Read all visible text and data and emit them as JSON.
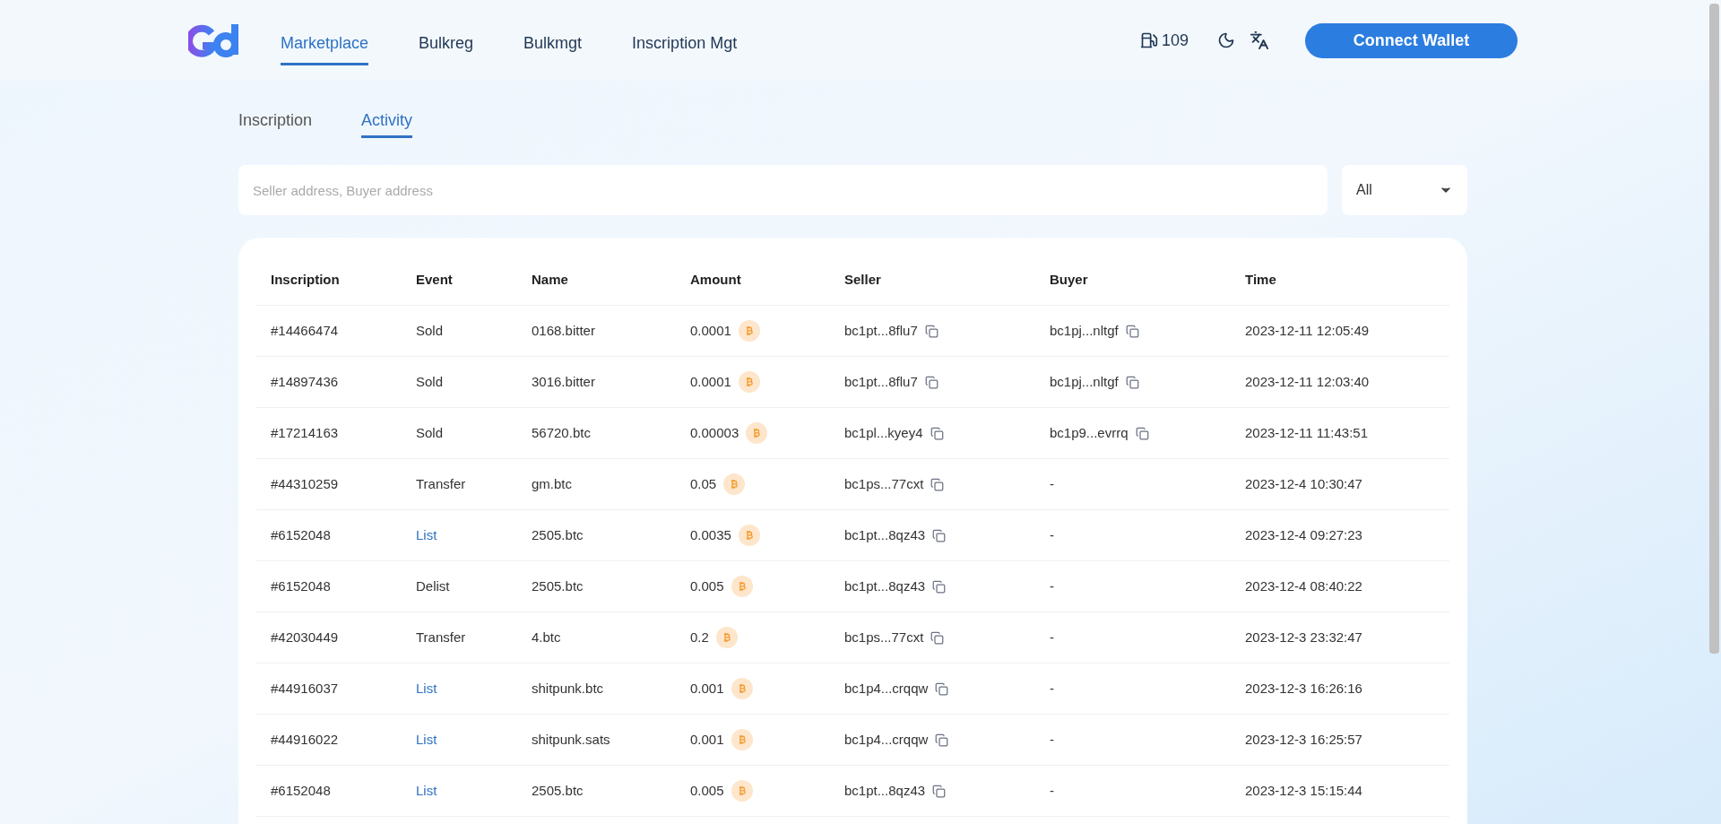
{
  "nav": {
    "items": [
      {
        "label": "Marketplace",
        "selected": true
      },
      {
        "label": "Bulkreg",
        "selected": false
      },
      {
        "label": "Bulkmgt",
        "selected": false
      },
      {
        "label": "Inscription Mgt",
        "selected": false
      }
    ],
    "gas": "109",
    "connect_button": "Connect Wallet"
  },
  "tabs": [
    {
      "label": "Inscription",
      "selected": false
    },
    {
      "label": "Activity",
      "selected": true
    }
  ],
  "search": {
    "placeholder": "Seller address, Buyer address"
  },
  "filter": {
    "value": "All"
  },
  "table": {
    "columns": [
      "Inscription",
      "Event",
      "Name",
      "Amount",
      "Seller",
      "Buyer",
      "Time"
    ],
    "rows": [
      {
        "inscription": "#14466474",
        "event": "Sold",
        "kind": "text",
        "name": "0168.bitter",
        "amount": "0.0001",
        "seller": "bc1pt...8flu7",
        "buyer": "bc1pj...nltgf",
        "time": "2023-12-11 12:05:49"
      },
      {
        "inscription": "#14897436",
        "event": "Sold",
        "kind": "text",
        "name": "3016.bitter",
        "amount": "0.0001",
        "seller": "bc1pt...8flu7",
        "buyer": "bc1pj...nltgf",
        "time": "2023-12-11 12:03:40"
      },
      {
        "inscription": "#17214163",
        "event": "Sold",
        "kind": "text",
        "name": "56720.btc",
        "amount": "0.00003",
        "seller": "bc1pl...kyey4",
        "buyer": "bc1p9...evrrq",
        "time": "2023-12-11 11:43:51"
      },
      {
        "inscription": "#44310259",
        "event": "Transfer",
        "kind": "text",
        "name": "gm.btc",
        "amount": "0.05",
        "seller": "bc1ps...77cxt",
        "buyer": "-",
        "time": "2023-12-4 10:30:47"
      },
      {
        "inscription": "#6152048",
        "event": "List",
        "kind": "link",
        "name": "2505.btc",
        "amount": "0.0035",
        "seller": "bc1pt...8qz43",
        "buyer": "-",
        "time": "2023-12-4 09:27:23"
      },
      {
        "inscription": "#6152048",
        "event": "Delist",
        "kind": "text",
        "name": "2505.btc",
        "amount": "0.005",
        "seller": "bc1pt...8qz43",
        "buyer": "-",
        "time": "2023-12-4 08:40:22"
      },
      {
        "inscription": "#42030449",
        "event": "Transfer",
        "kind": "text",
        "name": "4.btc",
        "amount": "0.2",
        "seller": "bc1ps...77cxt",
        "buyer": "-",
        "time": "2023-12-3 23:32:47"
      },
      {
        "inscription": "#44916037",
        "event": "List",
        "kind": "link",
        "name": "shitpunk.btc",
        "amount": "0.001",
        "seller": "bc1p4...crqqw",
        "buyer": "-",
        "time": "2023-12-3 16:26:16"
      },
      {
        "inscription": "#44916022",
        "event": "List",
        "kind": "link",
        "name": "shitpunk.sats",
        "amount": "0.001",
        "seller": "bc1p4...crqqw",
        "buyer": "-",
        "time": "2023-12-3 16:25:57"
      },
      {
        "inscription": "#6152048",
        "event": "List",
        "kind": "link",
        "name": "2505.btc",
        "amount": "0.005",
        "seller": "bc1pt...8qz43",
        "buyer": "-",
        "time": "2023-12-3 15:15:44"
      }
    ]
  }
}
